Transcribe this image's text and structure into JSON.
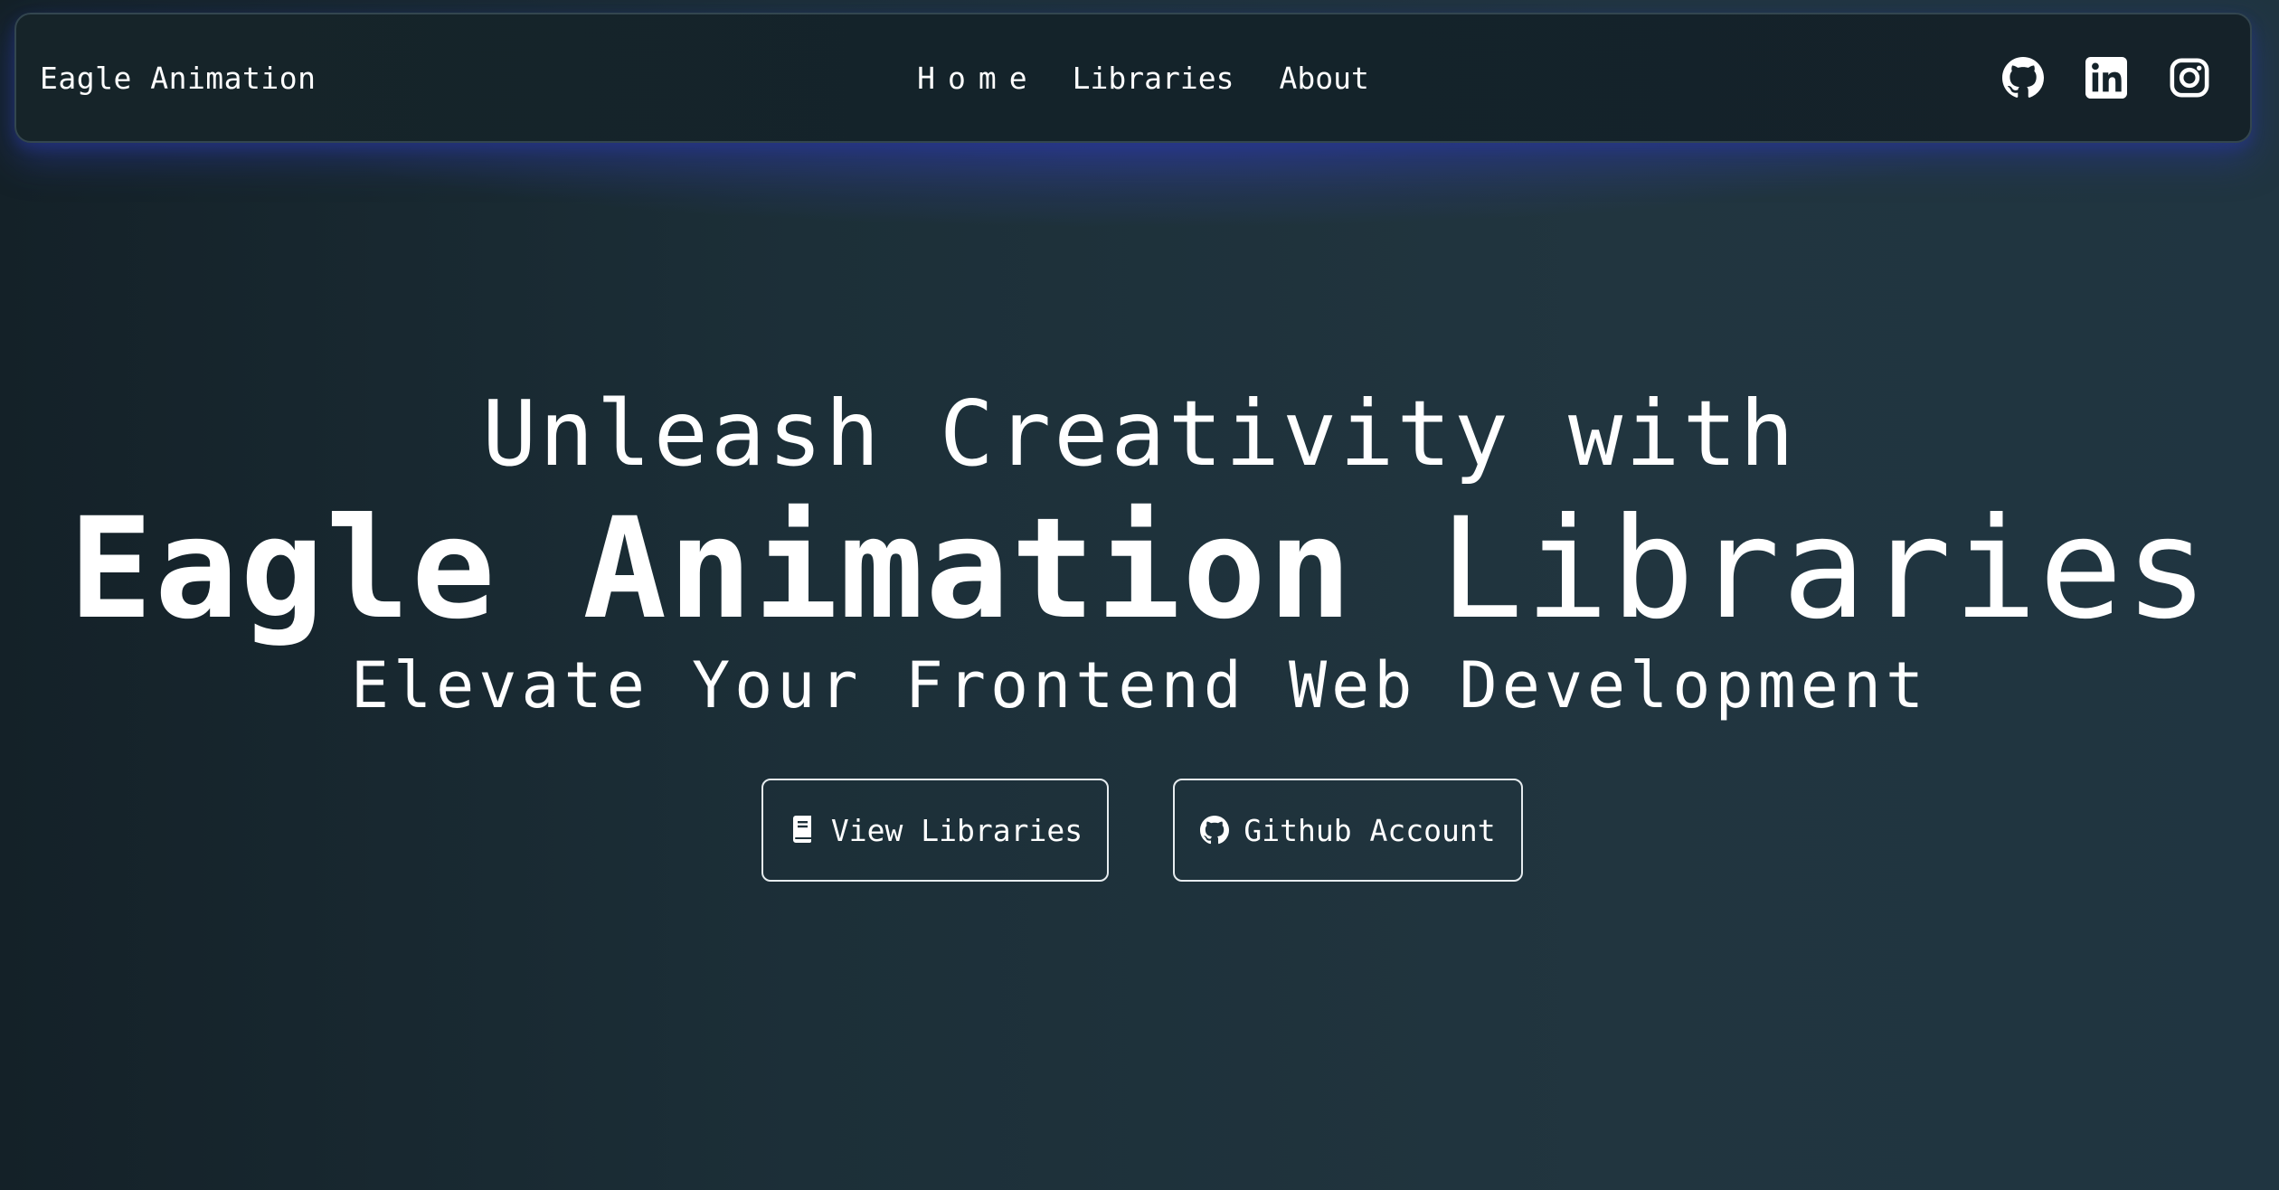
{
  "navbar": {
    "brand": "Eagle Animation",
    "links": [
      {
        "label": "Home"
      },
      {
        "label": "Libraries"
      },
      {
        "label": "About"
      }
    ],
    "social_icons": [
      "github-icon",
      "linkedin-icon",
      "instagram-icon"
    ]
  },
  "hero": {
    "line1": "Unleash Creativity with",
    "line2_bold": "Eagle Animation",
    "line2_regular": "Libraries",
    "line3": "Elevate Your Frontend Web Development",
    "buttons": [
      {
        "label": "View Libraries",
        "icon": "book-icon"
      },
      {
        "label": "Github Account",
        "icon": "github-icon"
      }
    ]
  },
  "colors": {
    "background": "#1c2f38",
    "navbar": "#14232a",
    "glow": "#303e96",
    "text": "#ffffff"
  }
}
